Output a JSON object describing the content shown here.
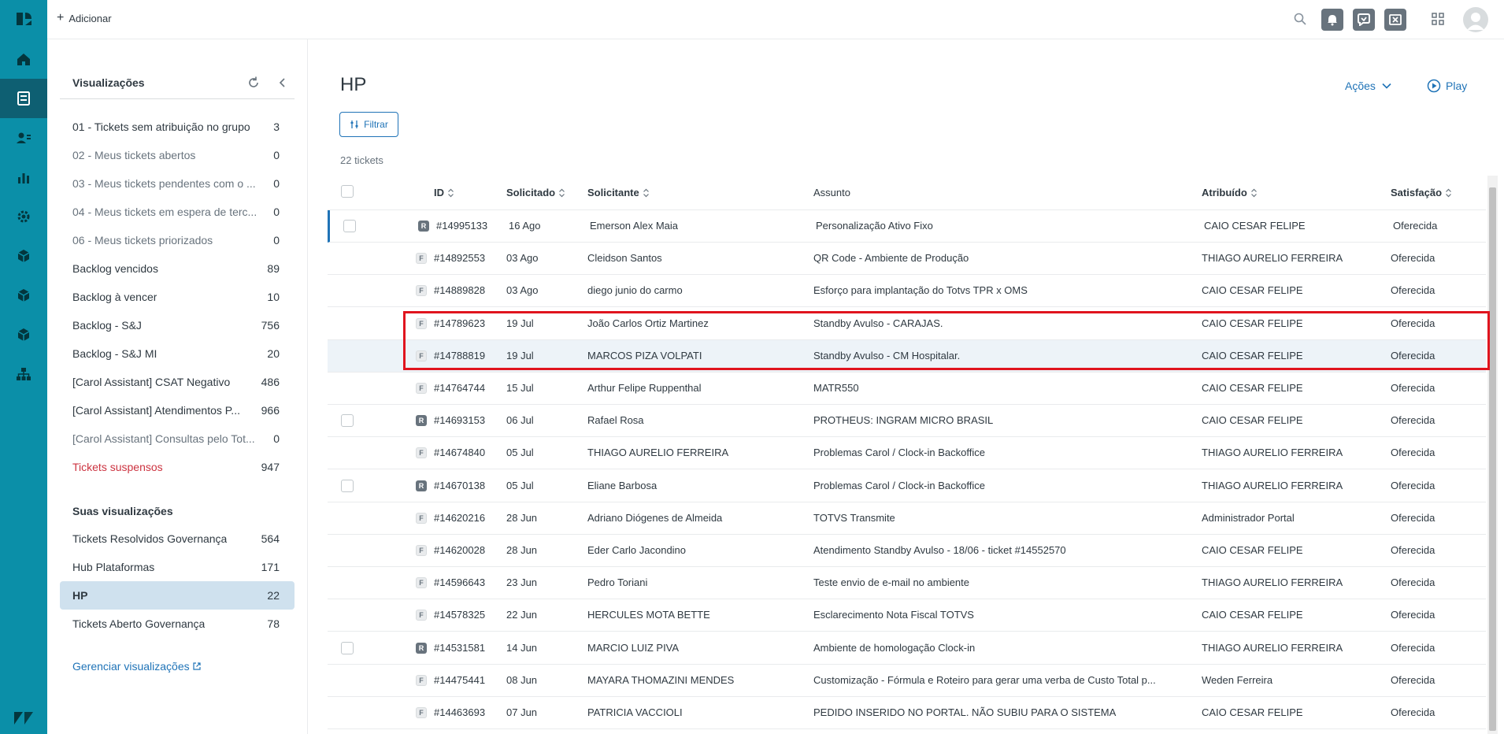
{
  "topbar": {
    "add_label": "Adicionar"
  },
  "views": {
    "heading": "Visualizações",
    "items": [
      {
        "label": "01 - Tickets sem atribuição no grupo",
        "count": "3",
        "style": "normal"
      },
      {
        "label": "02 - Meus tickets abertos",
        "count": "0",
        "style": "muted"
      },
      {
        "label": "03 - Meus tickets pendentes com o ...",
        "count": "0",
        "style": "muted"
      },
      {
        "label": "04 - Meus tickets em espera de terc...",
        "count": "0",
        "style": "muted"
      },
      {
        "label": "06 - Meus tickets priorizados",
        "count": "0",
        "style": "muted"
      },
      {
        "label": "Backlog vencidos",
        "count": "89",
        "style": "normal"
      },
      {
        "label": "Backlog à vencer",
        "count": "10",
        "style": "normal"
      },
      {
        "label": "Backlog - S&J",
        "count": "756",
        "style": "normal"
      },
      {
        "label": "Backlog - S&J MI",
        "count": "20",
        "style": "normal"
      },
      {
        "label": "[Carol Assistant] CSAT Negativo",
        "count": "486",
        "style": "normal"
      },
      {
        "label": "[Carol Assistant] Atendimentos P...",
        "count": "966",
        "style": "normal"
      },
      {
        "label": "[Carol Assistant] Consultas pelo Tot...",
        "count": "0",
        "style": "muted"
      },
      {
        "label": "Tickets suspensos",
        "count": "947",
        "style": "danger"
      }
    ],
    "your_views_heading": "Suas visualizações",
    "your_items": [
      {
        "label": "Tickets Resolvidos Governança",
        "count": "564"
      },
      {
        "label": "Hub Plataformas",
        "count": "171"
      },
      {
        "label": "HP",
        "count": "22"
      },
      {
        "label": "Tickets Aberto Governança",
        "count": "78"
      }
    ],
    "manage_label": "Gerenciar visualizações"
  },
  "main": {
    "title": "HP",
    "actions_label": "Ações",
    "play_label": "Play",
    "filter_label": "Filtrar",
    "ticket_count": "22 tickets"
  },
  "table": {
    "headers": {
      "id": "ID",
      "requested": "Solicitado",
      "requester": "Solicitante",
      "subject": "Assunto",
      "assignee": "Atribuído",
      "satisfaction": "Satisfação"
    },
    "rows": [
      {
        "checkbox": true,
        "type": "R",
        "id": "#14995133",
        "date": "16 Ago",
        "requester": "Emerson Alex Maia",
        "subject": "Personalização Ativo Fixo",
        "assignee": "CAIO CESAR FELIPE",
        "satisfaction": "Oferecida"
      },
      {
        "checkbox": false,
        "type": "F",
        "id": "#14892553",
        "date": "03 Ago",
        "requester": "Cleidson Santos",
        "subject": "QR Code - Ambiente de Produção",
        "assignee": "THIAGO AURELIO FERREIRA",
        "satisfaction": "Oferecida"
      },
      {
        "checkbox": false,
        "type": "F",
        "id": "#14889828",
        "date": "03 Ago",
        "requester": "diego junio do carmo",
        "subject": "Esforço para implantação do Totvs TPR x OMS",
        "assignee": "CAIO CESAR FELIPE",
        "satisfaction": "Oferecida"
      },
      {
        "checkbox": false,
        "type": "F",
        "id": "#14789623",
        "date": "19 Jul",
        "requester": "João Carlos Ortiz Martinez",
        "subject": "Standby Avulso - CARAJAS.",
        "assignee": "CAIO CESAR FELIPE",
        "satisfaction": "Oferecida"
      },
      {
        "checkbox": false,
        "type": "F",
        "id": "#14788819",
        "date": "19 Jul",
        "requester": "MARCOS PIZA VOLPATI",
        "subject": "Standby Avulso - CM Hospitalar.",
        "assignee": "CAIO CESAR FELIPE",
        "satisfaction": "Oferecida"
      },
      {
        "checkbox": false,
        "type": "F",
        "id": "#14764744",
        "date": "15 Jul",
        "requester": "Arthur Felipe Ruppenthal",
        "subject": "MATR550",
        "assignee": "CAIO CESAR FELIPE",
        "satisfaction": "Oferecida"
      },
      {
        "checkbox": true,
        "type": "R",
        "id": "#14693153",
        "date": "06 Jul",
        "requester": "Rafael Rosa",
        "subject": "PROTHEUS: INGRAM MICRO BRASIL",
        "assignee": "CAIO CESAR FELIPE",
        "satisfaction": "Oferecida"
      },
      {
        "checkbox": false,
        "type": "F",
        "id": "#14674840",
        "date": "05 Jul",
        "requester": "THIAGO AURELIO FERREIRA",
        "subject": "Problemas Carol / Clock-in Backoffice",
        "assignee": "THIAGO AURELIO FERREIRA",
        "satisfaction": "Oferecida"
      },
      {
        "checkbox": true,
        "type": "R",
        "id": "#14670138",
        "date": "05 Jul",
        "requester": "Eliane Barbosa",
        "subject": "Problemas Carol / Clock-in Backoffice",
        "assignee": "THIAGO AURELIO FERREIRA",
        "satisfaction": "Oferecida"
      },
      {
        "checkbox": false,
        "type": "F",
        "id": "#14620216",
        "date": "28 Jun",
        "requester": "Adriano Diógenes de Almeida",
        "subject": "TOTVS Transmite",
        "assignee": "Administrador Portal",
        "satisfaction": "Oferecida"
      },
      {
        "checkbox": false,
        "type": "F",
        "id": "#14620028",
        "date": "28 Jun",
        "requester": "Eder Carlo Jacondino",
        "subject": "Atendimento Standby Avulso - 18/06 - ticket #14552570",
        "assignee": "CAIO CESAR FELIPE",
        "satisfaction": "Oferecida"
      },
      {
        "checkbox": false,
        "type": "F",
        "id": "#14596643",
        "date": "23 Jun",
        "requester": "Pedro Toriani",
        "subject": "Teste envio de e-mail no ambiente",
        "assignee": "THIAGO AURELIO FERREIRA",
        "satisfaction": "Oferecida"
      },
      {
        "checkbox": false,
        "type": "F",
        "id": "#14578325",
        "date": "22 Jun",
        "requester": "HERCULES MOTA BETTE",
        "subject": "Esclarecimento Nota Fiscal TOTVS",
        "assignee": "CAIO CESAR FELIPE",
        "satisfaction": "Oferecida"
      },
      {
        "checkbox": true,
        "type": "R",
        "id": "#14531581",
        "date": "14 Jun",
        "requester": "MARCIO LUIZ PIVA",
        "subject": "Ambiente de homologação Clock-in",
        "assignee": "THIAGO AURELIO FERREIRA",
        "satisfaction": "Oferecida"
      },
      {
        "checkbox": false,
        "type": "F",
        "id": "#14475441",
        "date": "08 Jun",
        "requester": "MAYARA THOMAZINI MENDES",
        "subject": "Customização - Fórmula e Roteiro para gerar uma verba de Custo Total p...",
        "assignee": "Weden Ferreira",
        "satisfaction": "Oferecida"
      },
      {
        "checkbox": false,
        "type": "F",
        "id": "#14463693",
        "date": "07 Jun",
        "requester": "PATRICIA VACCIOLI",
        "subject": "PEDIDO INSERIDO NO PORTAL. NÃO SUBIU PARA O SISTEMA",
        "assignee": "CAIO CESAR FELIPE",
        "satisfaction": "Oferecida"
      }
    ]
  },
  "colors": {
    "rail": "#0b8fa8",
    "accent": "#1f73b7",
    "highlight": "#e0141e",
    "danger": "#cc3340"
  }
}
